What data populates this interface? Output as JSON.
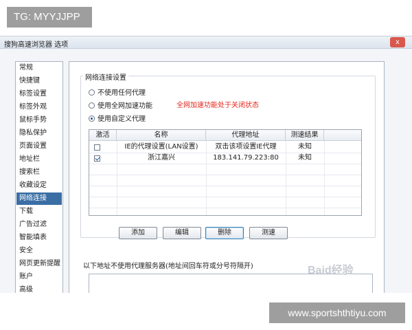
{
  "overlay": {
    "tag": "TG: MYYJJPP",
    "url": "www.sportshthtiyu.com",
    "watermark": "Baid经验"
  },
  "window": {
    "title": "搜狗高速浏览器 选项",
    "close_label": "x"
  },
  "sidebar": {
    "items": [
      {
        "label": "常规"
      },
      {
        "label": "快捷键"
      },
      {
        "label": "标签设置"
      },
      {
        "label": "标签外观"
      },
      {
        "label": "鼠标手势"
      },
      {
        "label": "隐私保护"
      },
      {
        "label": "页面设置"
      },
      {
        "label": "地址栏"
      },
      {
        "label": "搜索栏"
      },
      {
        "label": "收藏设定"
      },
      {
        "label": "网络连接",
        "selected": true
      },
      {
        "label": "下载"
      },
      {
        "label": "广告过滤"
      },
      {
        "label": "智能填表"
      },
      {
        "label": "安全"
      },
      {
        "label": "网页更新提醒"
      },
      {
        "label": "账户"
      },
      {
        "label": "高级"
      }
    ]
  },
  "network": {
    "group_title": "网络连接设置",
    "options": [
      {
        "label": "不使用任何代理",
        "checked": false
      },
      {
        "label": "使用全网加速功能",
        "checked": false
      },
      {
        "label": "使用自定义代理",
        "checked": true
      }
    ],
    "acceleration_note": "全网加速功能处于关闭状态",
    "table": {
      "headers": [
        "激活",
        "名称",
        "代理地址",
        "测速结果"
      ],
      "rows": [
        {
          "active": false,
          "name": "IE的代理设置(LAN设置)",
          "address": "双击该项设置IE代理",
          "result": "未知"
        },
        {
          "active": true,
          "name": "浙江嘉兴",
          "address": "183.141.79.223:80",
          "result": "未知"
        }
      ]
    },
    "buttons": {
      "add": "添加",
      "edit": "编辑",
      "delete": "删除",
      "test": "测速"
    },
    "bypass_label": "以下地址不使用代理服务器(地址间回车符或分号符隔开)"
  }
}
